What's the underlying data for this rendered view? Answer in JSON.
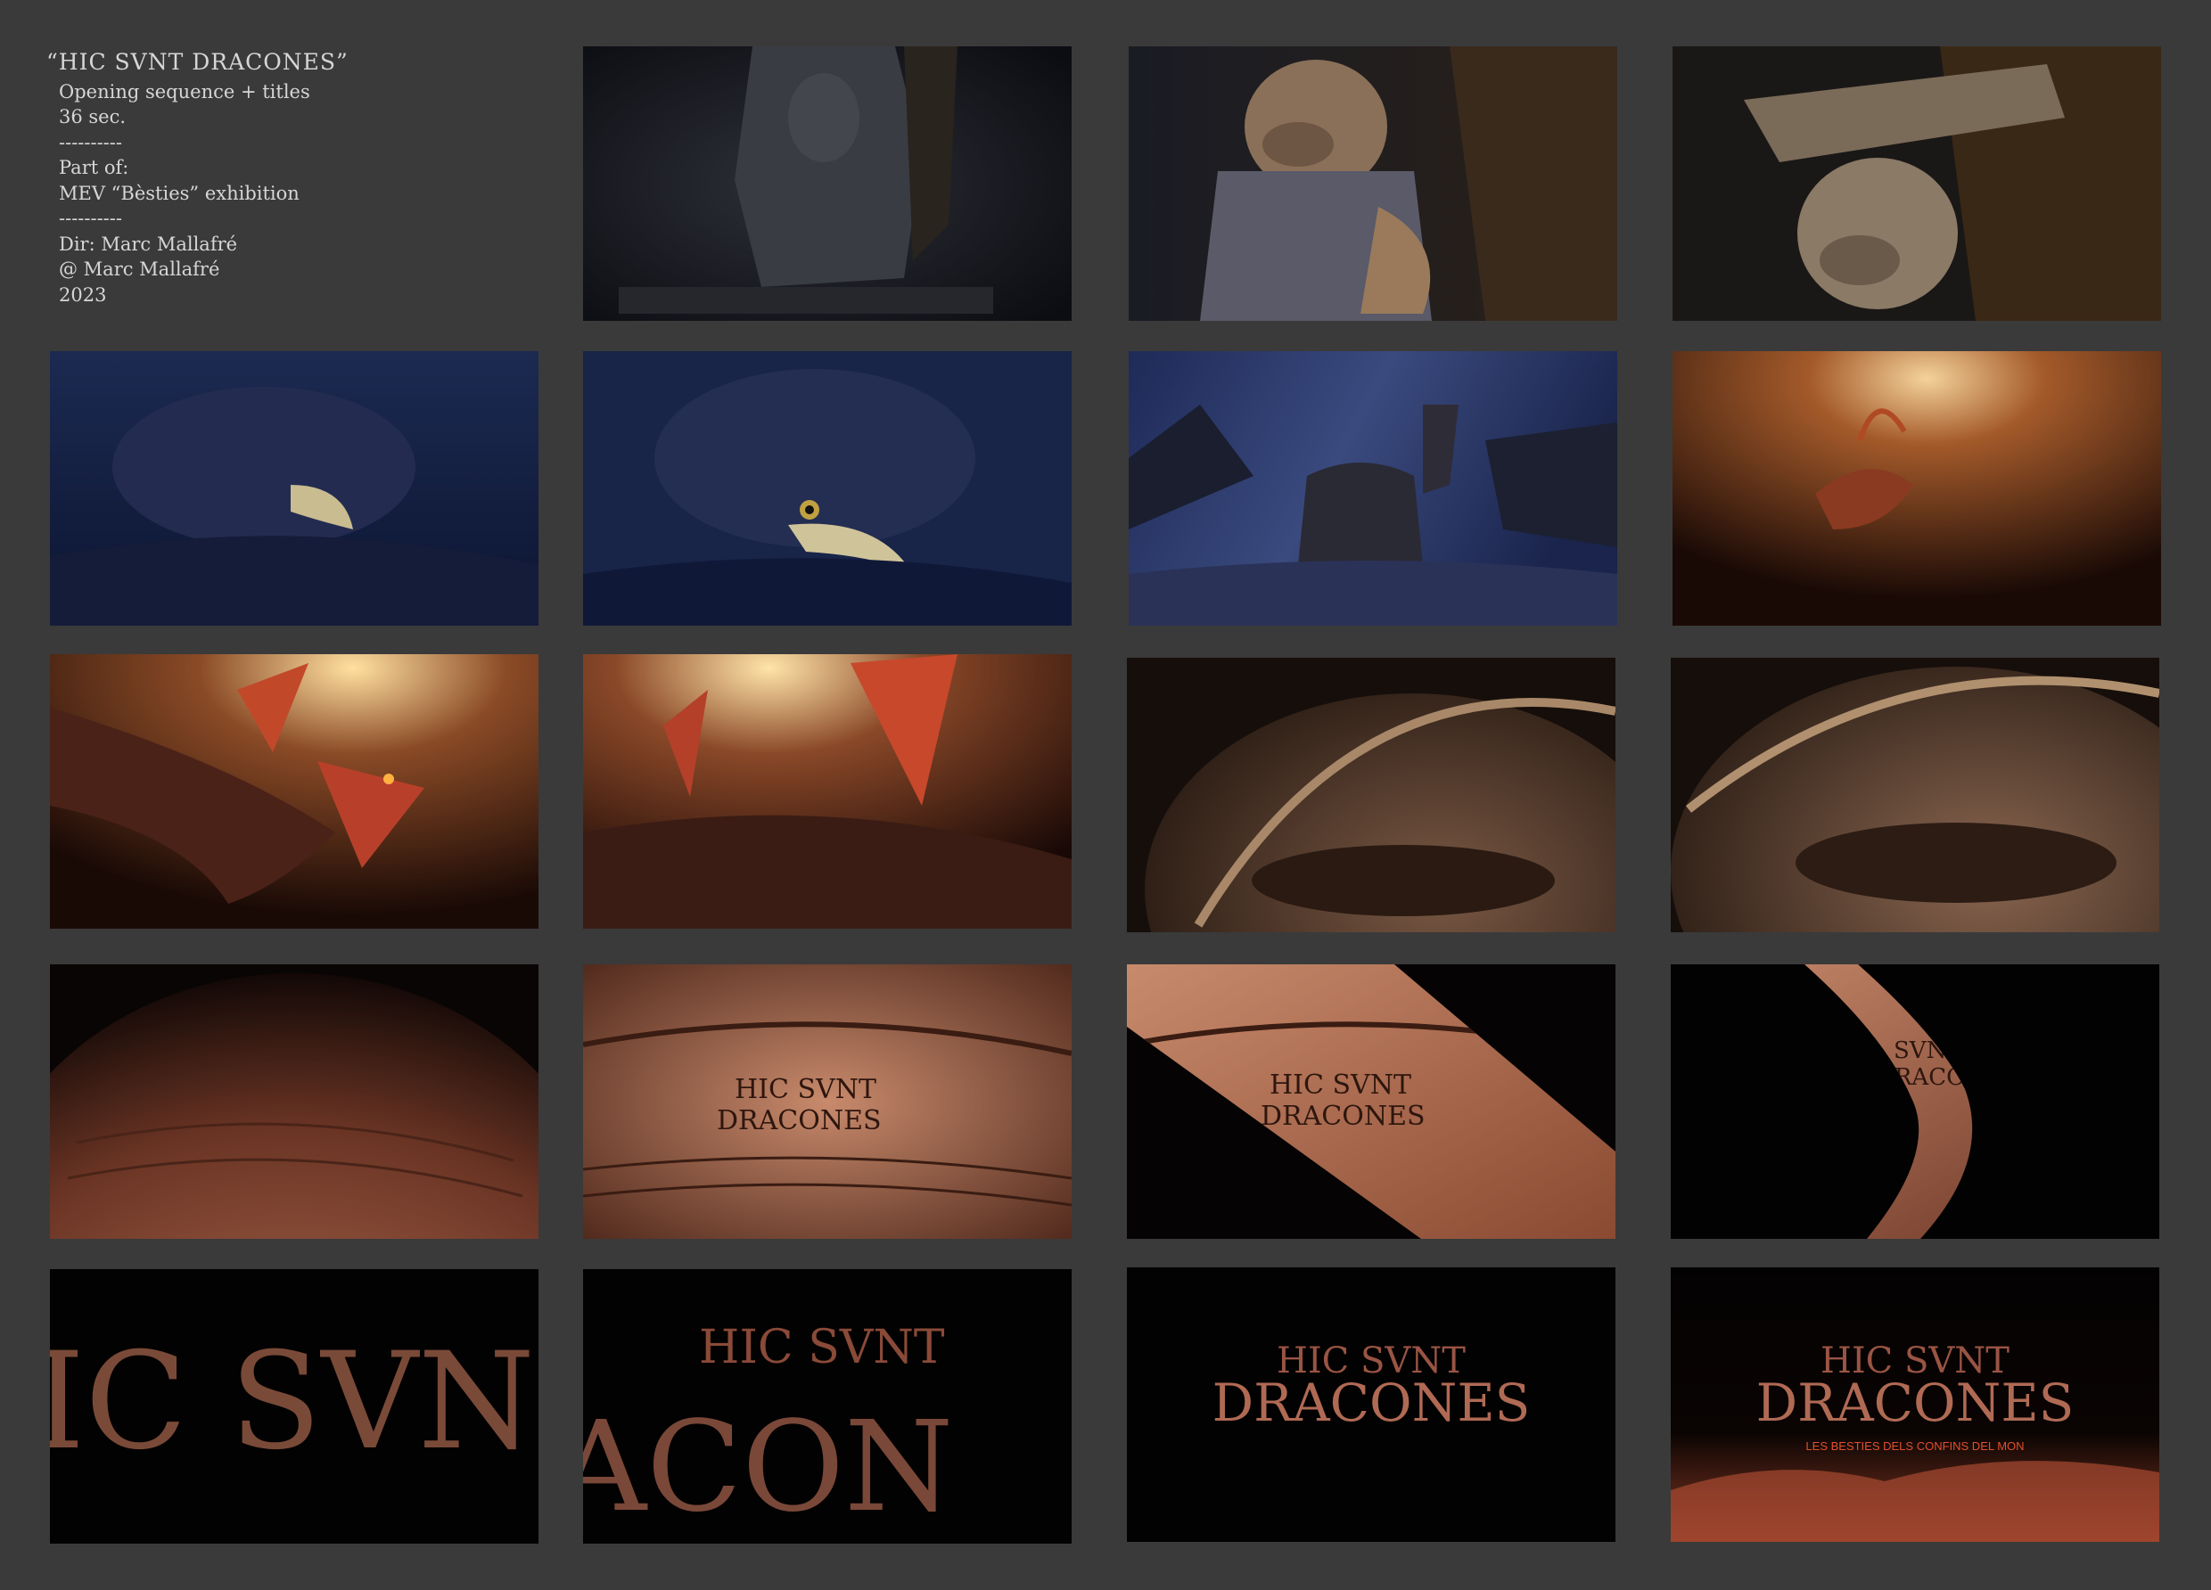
{
  "credits": {
    "title": "“HIC SVNT DRACONES”",
    "lines": [
      "Opening sequence + titles",
      "36 sec.",
      "----------",
      "Part of:",
      "MEV “Bèsties” exhibition",
      "----------",
      "Dir: Marc Mallafré",
      "@ Marc Mallafré",
      "2023"
    ]
  },
  "frames": {
    "f02": {
      "desc": "stone statue base"
    },
    "f03": {
      "desc": "ape statue"
    },
    "f04": {
      "desc": "ape statue with stone slab"
    },
    "f05": {
      "desc": "griffin head closed eye"
    },
    "f06": {
      "desc": "griffin head open eye"
    },
    "f07": {
      "desc": "griffin under night sky"
    },
    "f08": {
      "desc": "creature in orange glow"
    },
    "f09": {
      "desc": "winged dragon"
    },
    "f10": {
      "desc": "dragon wings"
    },
    "f11": {
      "desc": "dragon eye closed"
    },
    "f12": {
      "desc": "dragon eye"
    },
    "f13": {
      "desc": "copper globe"
    },
    "f14_map_text": [
      "HIC SVNT",
      "DRACONES"
    ],
    "f15_map_text": [
      "HIC SVNT",
      "DRACONES"
    ],
    "f16_map_text": [
      "SVNT",
      "DRACONES"
    ],
    "f17_title": "IC SVN",
    "f18_title": [
      "HIC SVNT",
      "ACON"
    ],
    "f19_title": [
      "HIC SVNT",
      "DRACONES"
    ],
    "f20_title": [
      "HIC SVNT",
      "DRACONES"
    ],
    "f20_subtitle": "LES BESTIES DELS CONFINS DEL MON"
  },
  "colors": {
    "background": "#3a3a3a",
    "credit_text": "#d6d6d6",
    "copper": "#c9806a",
    "night_blue": "#1c2a52"
  }
}
